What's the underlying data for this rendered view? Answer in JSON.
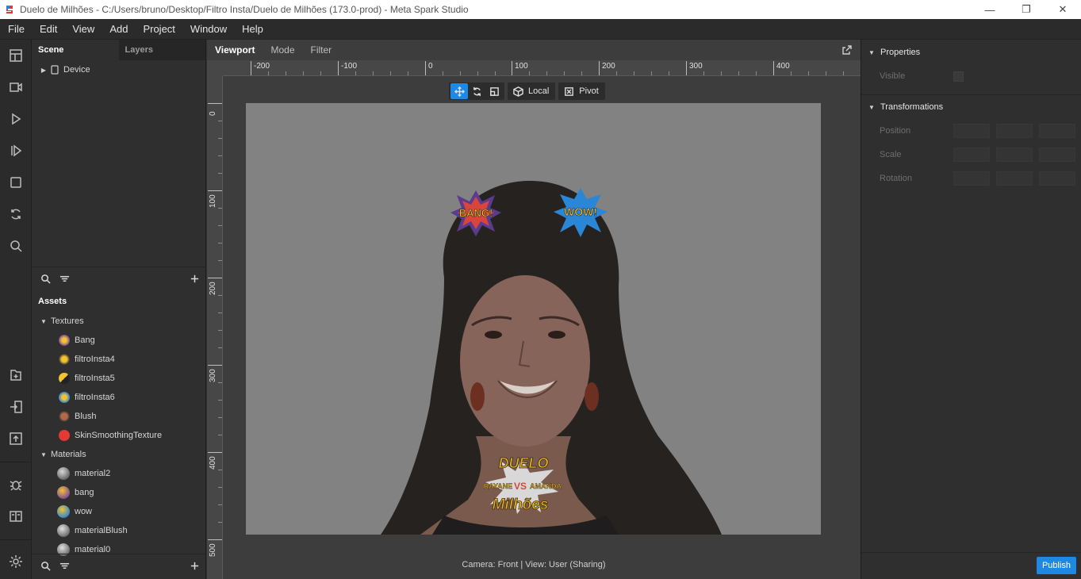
{
  "window": {
    "title": "Duelo de Milhões - C:/Users/bruno/Desktop/Filtro Insta/Duelo de Milhões (173.0-prod) - Meta Spark Studio",
    "app_icon": "spark-logo-icon",
    "controls": [
      "minimize-icon",
      "restore-icon",
      "close-icon"
    ]
  },
  "menu": {
    "items": [
      "File",
      "Edit",
      "View",
      "Add",
      "Project",
      "Window",
      "Help"
    ]
  },
  "rail": {
    "icons": [
      "layout-icon",
      "camera-video-icon",
      "play-icon",
      "step-play-icon",
      "square-icon",
      "sync-icon",
      "search-icon",
      "add-file-icon",
      "import-icon",
      "export-upload-icon",
      "bug-icon",
      "docs-icon",
      "settings-gear-icon"
    ]
  },
  "scene": {
    "tab_scene": "Scene",
    "tab_layers": "Layers",
    "root_item": "Device"
  },
  "assets": {
    "title": "Assets",
    "textures_label": "Textures",
    "textures": [
      "Bang",
      "filtroInsta4",
      "filtroInsta5",
      "filtroInsta6",
      "Blush",
      "SkinSmoothingTexture"
    ],
    "materials_label": "Materials",
    "materials": [
      "material2",
      "bang",
      "wow",
      "materialBlush",
      "material0"
    ]
  },
  "viewport": {
    "tabs": [
      "Viewport",
      "Mode",
      "Filter"
    ],
    "ruler_h": [
      "-200",
      "-100",
      "0",
      "100",
      "200",
      "300",
      "400"
    ],
    "ruler_v": [
      "0",
      "100",
      "200",
      "300",
      "400",
      "500"
    ],
    "gizmo_local": "Local",
    "gizmo_pivot": "Pivot",
    "status": "Camera: Front | View: User (Sharing)",
    "stickers": {
      "bang": "BANG!",
      "wow": "WOW!",
      "logo_top": "DUELO",
      "logo_left": "RAYANE",
      "logo_right": "AMANDA",
      "logo_vs": "VS",
      "logo_bottom": "Milhões"
    }
  },
  "properties": {
    "section_properties": "Properties",
    "visible_label": "Visible",
    "section_transformations": "Transformations",
    "position_label": "Position",
    "scale_label": "Scale",
    "rotation_label": "Rotation",
    "publish": "Publish"
  },
  "colors": {
    "accent": "#1e88e5",
    "skin_texture_dot": "#e53935"
  }
}
